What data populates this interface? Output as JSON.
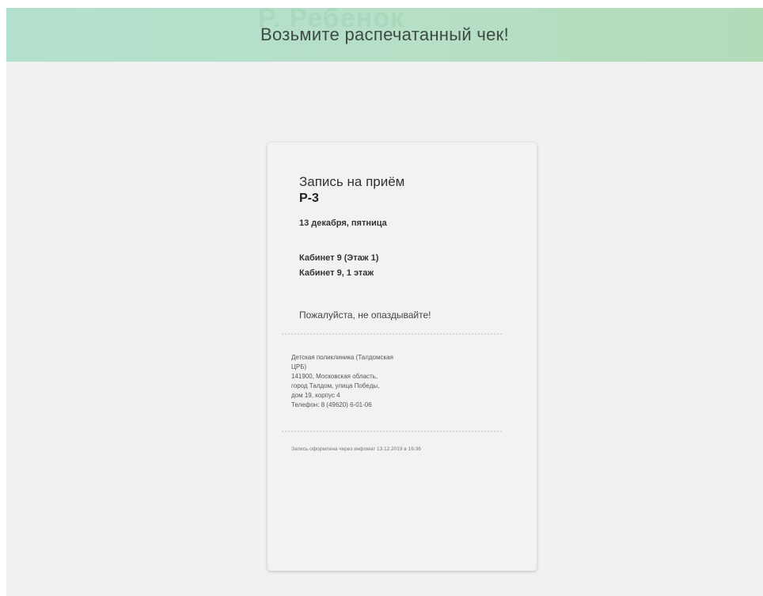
{
  "banner": {
    "message": "Возьмите распечатанный чек!"
  },
  "receipt": {
    "title": "Запись на приём",
    "code": "Р-3",
    "date": "13 декабря, пятница",
    "room_line_1": "Кабинет 9 (Этаж 1)",
    "room_line_2": "Кабинет 9, 1 этаж",
    "note": "Пожалуйста, не опаздывайте!",
    "address_lines": [
      "Детская поликлиника (Талдомская",
      "ЦРБ)",
      "141900, Московская область,",
      "город Талдом, улица Победы,",
      "дом 19, корпус 4",
      "Телефон: 8 (49620) 6-01-06"
    ],
    "footer": "Запись оформлена через инфомат 13.12.2019 в 16:36"
  },
  "colors": {
    "banner_bg": "#b5dfc8",
    "page_bg": "#f1f1f1",
    "receipt_bg": "#f2f2f2"
  }
}
